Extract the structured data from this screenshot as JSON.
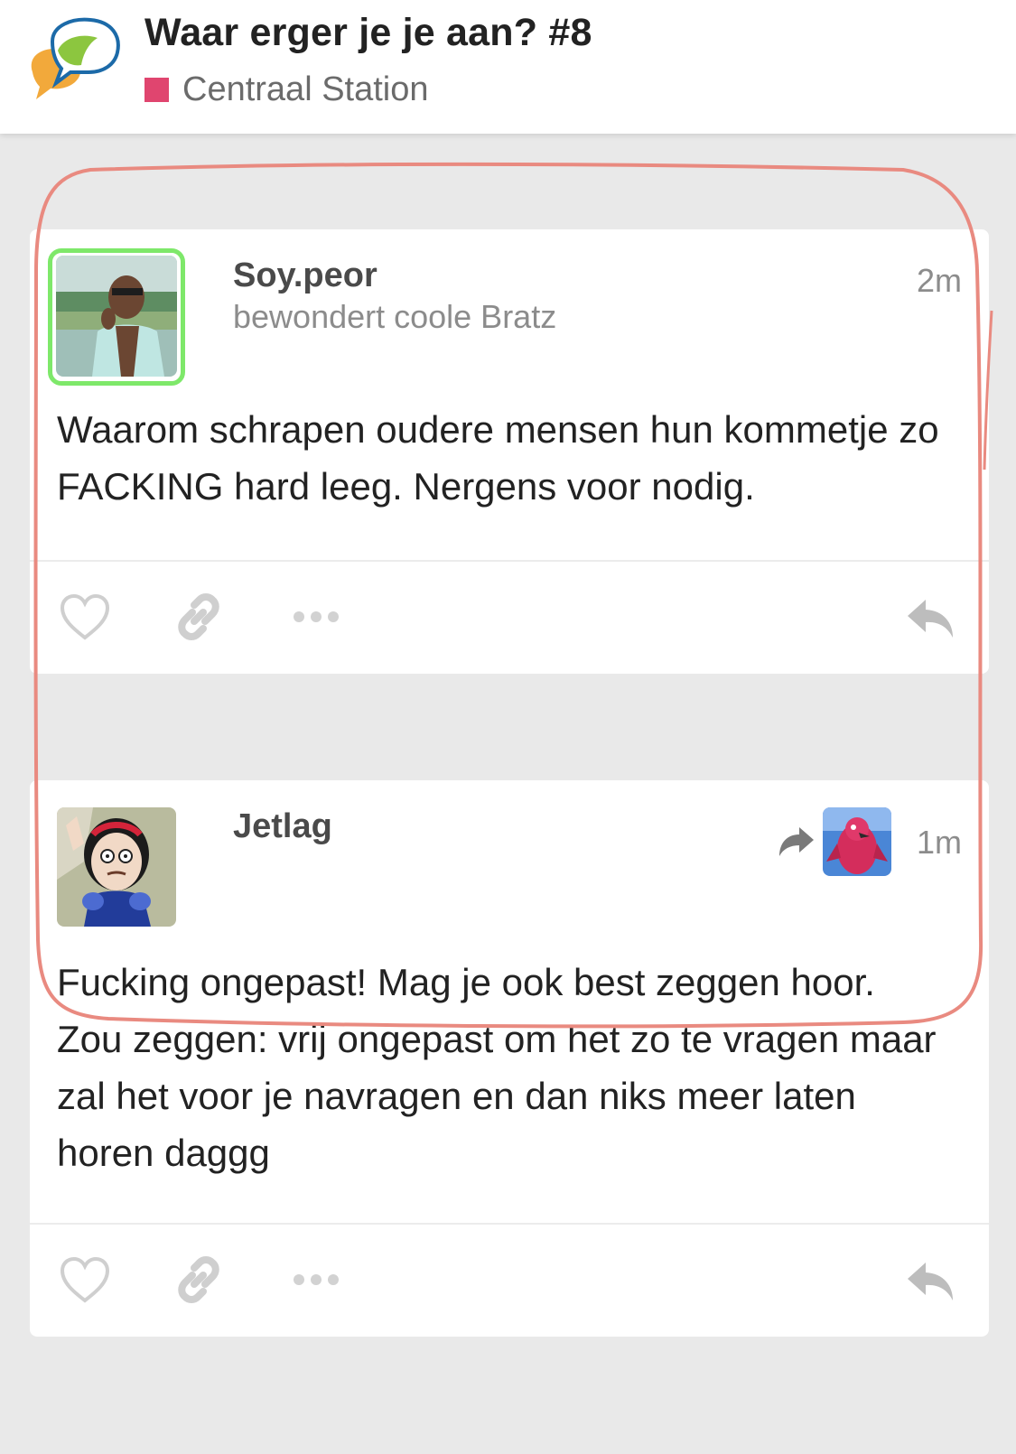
{
  "header": {
    "title": "Waar erger je je aan? #8",
    "category": "Centraal Station",
    "category_color": "#e0456f"
  },
  "posts": [
    {
      "username": "Soy.peor",
      "user_title": "bewondert coole Bratz",
      "time": "2m",
      "body": [
        "Waarom schrapen oudere mensen hun kommetje zo FACKING hard leeg. Nergens voor nodig."
      ],
      "avatar_ring_color": "#7ee86a"
    },
    {
      "username": "Jetlag",
      "time": "1m",
      "body": [
        "Fucking ongepast! Mag je ook best zeggen hoor.",
        "Zou zeggen: vrij ongepast om het zo te vragen maar zal het voor je navragen en dan niks meer laten horen daggg"
      ]
    }
  ],
  "icons": {
    "logo": "speech-bubbles-logo",
    "like": "heart-icon",
    "link": "link-icon",
    "more": "ellipsis-icon",
    "reply": "reply-icon",
    "reply_to": "share-arrow-icon"
  },
  "colors": {
    "icon_gray": "#c9c9c9",
    "highlight": "#e98a80"
  }
}
